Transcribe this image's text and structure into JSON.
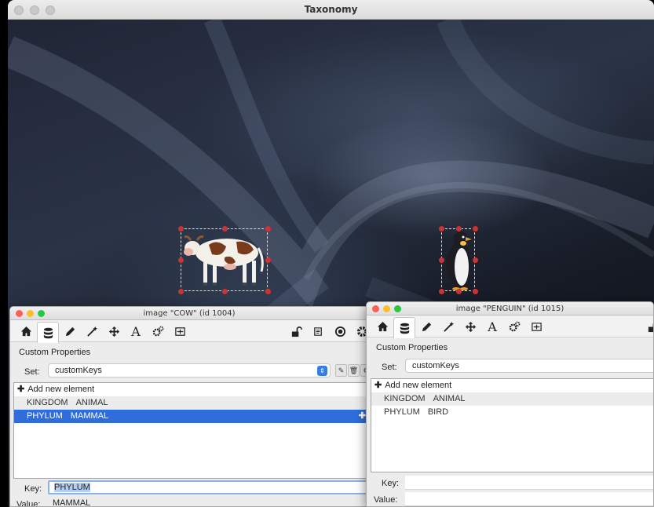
{
  "main_window": {
    "title": "Taxonomy",
    "canvas_images": [
      {
        "name": "COW",
        "icon": "cow-image"
      },
      {
        "name": "PENGUIN",
        "icon": "penguin-image"
      }
    ]
  },
  "inspectors": [
    {
      "title": "image \"COW\" (id 1004)",
      "toolbar_icons": [
        "home-icon",
        "database-icon",
        "pencil-icon",
        "magic-wand-icon",
        "move-icon",
        "text-icon",
        "gears-icon",
        "resize-icon",
        "lock-icon",
        "script-icon",
        "target-icon",
        "gear-icon"
      ],
      "section_title": "Custom Properties",
      "set_label": "Set:",
      "set_value": "customKeys",
      "add_label": "Add new element",
      "rows": [
        {
          "key": "KINGDOM",
          "value": "ANIMAL",
          "selected": false
        },
        {
          "key": "PHYLUM",
          "value": "MAMMAL",
          "selected": true
        }
      ],
      "key_label": "Key:",
      "key_value": "PHYLUM",
      "value_label": "Value:",
      "value_value": "MAMMAL"
    },
    {
      "title": "image \"PENGUIN\" (id 1015)",
      "toolbar_icons": [
        "home-icon",
        "database-icon",
        "pencil-icon",
        "magic-wand-icon",
        "move-icon",
        "text-icon",
        "gears-icon",
        "resize-icon",
        "lock-icon"
      ],
      "section_title": "Custom Properties",
      "set_label": "Set:",
      "set_value": "customKeys",
      "add_label": "Add new element",
      "rows": [
        {
          "key": "KINGDOM",
          "value": "ANIMAL",
          "selected": false
        },
        {
          "key": "PHYLUM",
          "value": "BIRD",
          "selected": false
        }
      ],
      "key_label": "Key:",
      "key_value": "",
      "value_label": "Value:",
      "value_value": ""
    }
  ],
  "colors": {
    "selection": "#2e6ddb",
    "handle": "#cc3333",
    "stepper": "#3a7de0"
  }
}
